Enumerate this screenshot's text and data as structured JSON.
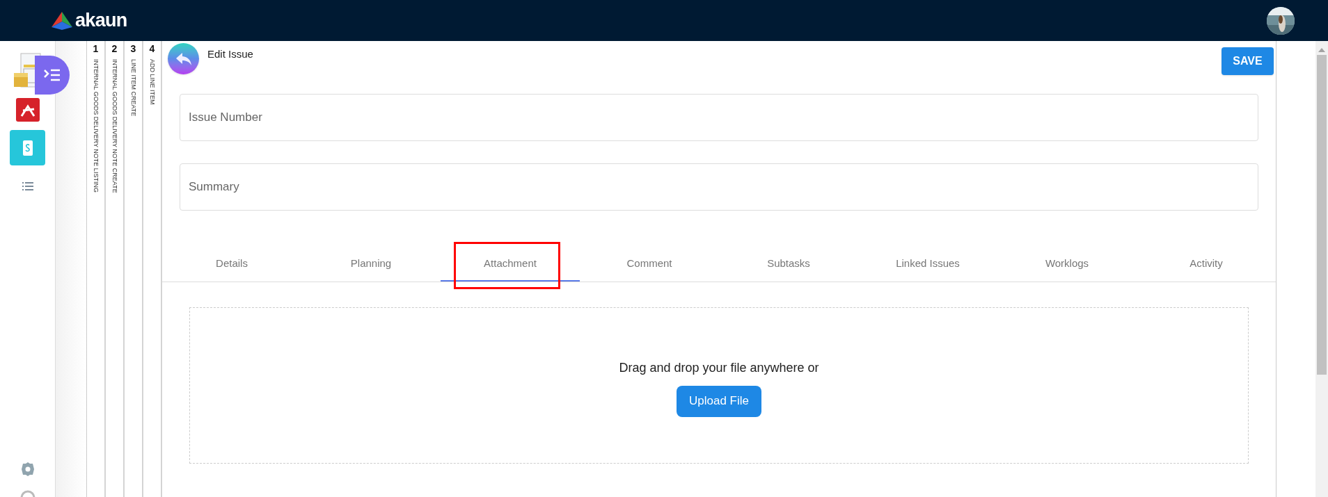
{
  "header": {
    "logo": "akaun"
  },
  "breadcrumbs": [
    {
      "number": "1",
      "label": "INTERNAL GOODS DELIVERY NOTE LISTING"
    },
    {
      "number": "2",
      "label": "INTERNAL GOODS DELIVERY NOTE CREATE"
    },
    {
      "number": "3",
      "label": "LINE ITEM CREATE"
    },
    {
      "number": "4",
      "label": "ADD LINE ITEM"
    }
  ],
  "page": {
    "title": "Edit Issue",
    "save_button": "SAVE"
  },
  "fields": [
    {
      "placeholder": "Issue Number"
    },
    {
      "placeholder": "Summary"
    }
  ],
  "tabs": [
    {
      "label": "Details",
      "selected": false
    },
    {
      "label": "Planning",
      "selected": false
    },
    {
      "label": "Attachment",
      "selected": true
    },
    {
      "label": "Comment",
      "selected": false
    },
    {
      "label": "Subtasks",
      "selected": false
    },
    {
      "label": "Linked Issues",
      "selected": false
    },
    {
      "label": "Worklogs",
      "selected": false
    },
    {
      "label": "Activity",
      "selected": false
    }
  ],
  "dropzone": {
    "text": "Drag and drop your file anywhere or",
    "button": "Upload File"
  }
}
